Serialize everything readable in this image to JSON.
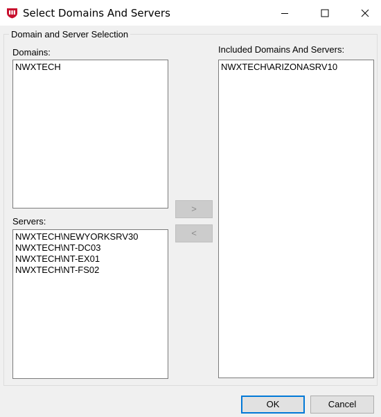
{
  "window": {
    "title": "Select Domains And Servers",
    "accent": "#c8102e"
  },
  "group": {
    "legend": "Domain and Server Selection"
  },
  "domains": {
    "label": "Domains:",
    "items": [
      "NWXTECH"
    ]
  },
  "servers": {
    "label": "Servers:",
    "items": [
      "NWXTECH\\NEWYORKSRV30",
      "NWXTECH\\NT-DC03",
      "NWXTECH\\NT-EX01",
      "NWXTECH\\NT-FS02"
    ]
  },
  "included": {
    "label": "Included Domains And Servers:",
    "items": [
      "NWXTECH\\ARIZONASRV10"
    ]
  },
  "move": {
    "add_label": ">",
    "remove_label": "<"
  },
  "buttons": {
    "ok": "OK",
    "cancel": "Cancel"
  },
  "icons": {
    "app": "shield-logo-icon",
    "minimize": "minimize-icon",
    "maximize": "maximize-icon",
    "close": "close-icon"
  }
}
